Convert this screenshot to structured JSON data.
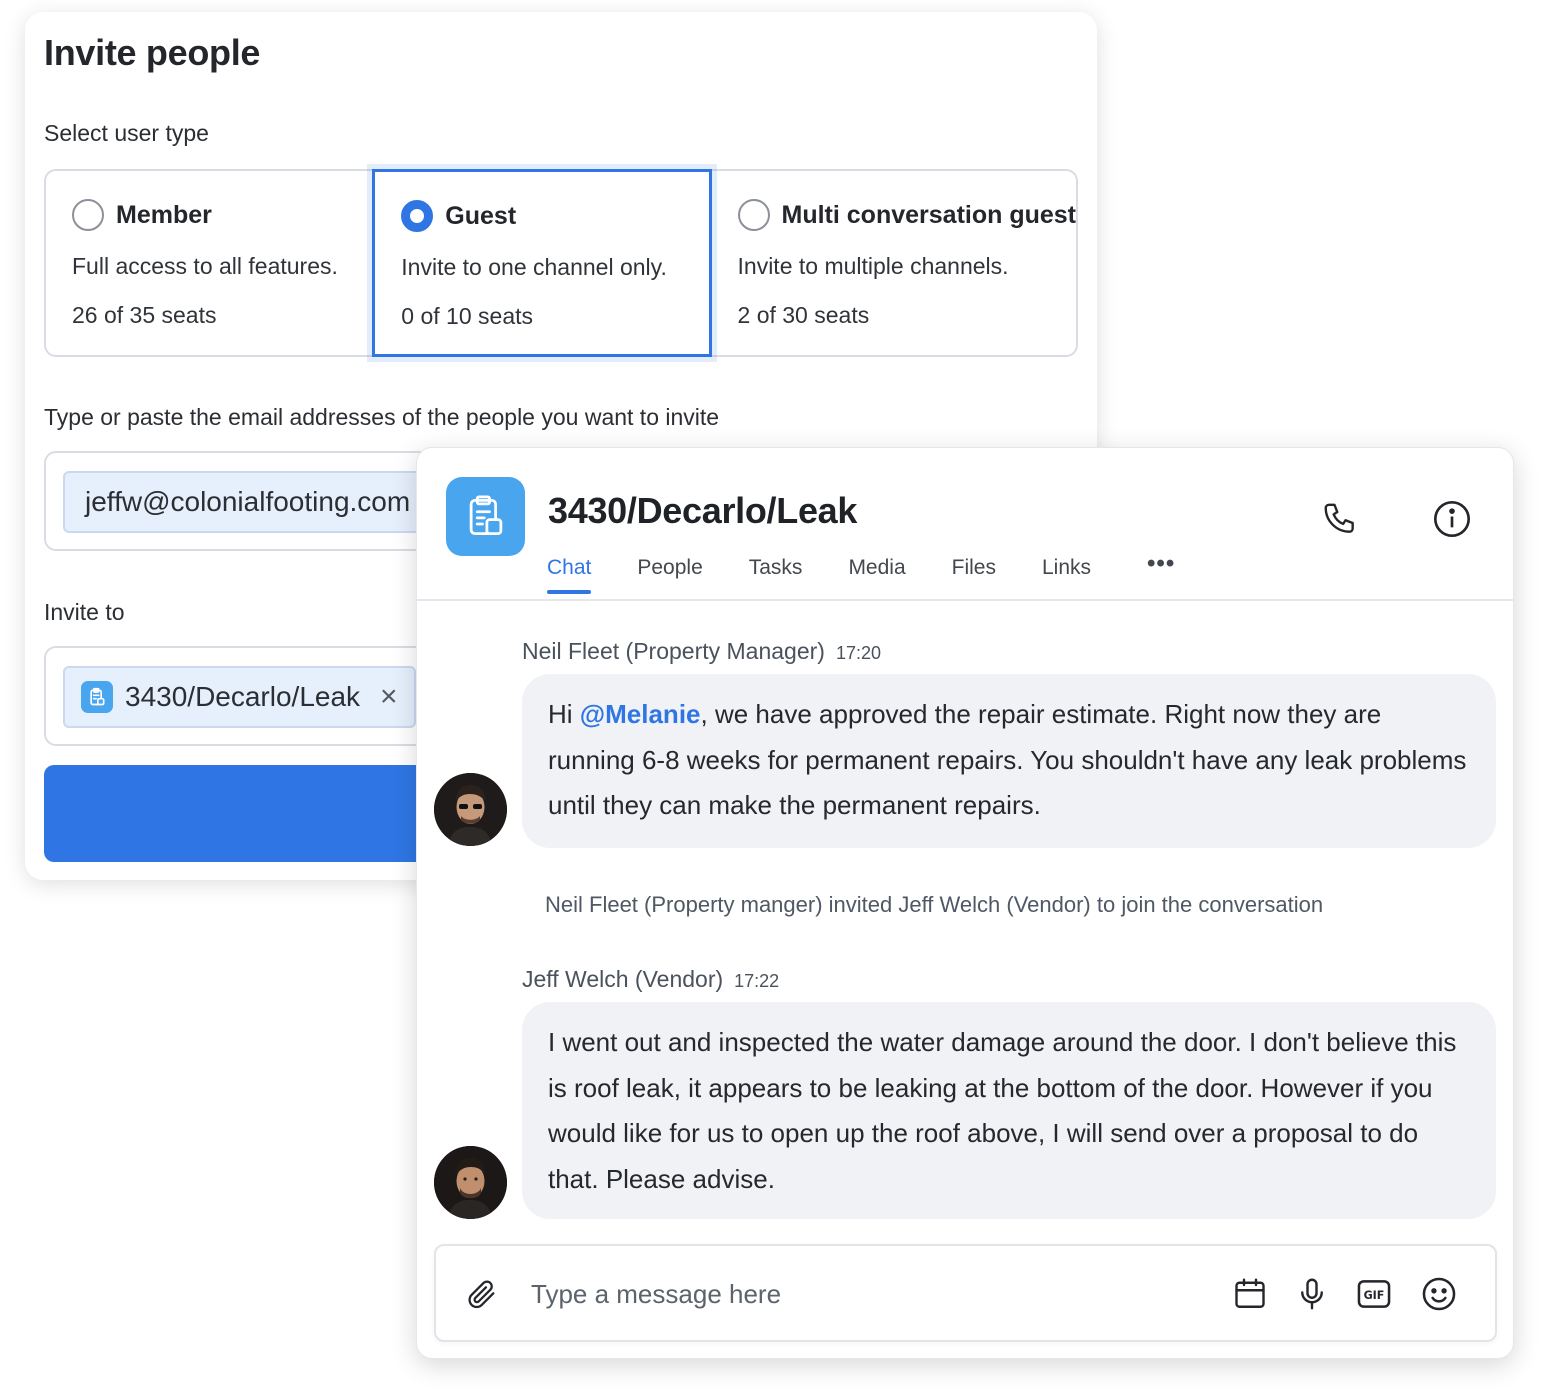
{
  "invite": {
    "title": "Invite people",
    "user_type_label": "Select user type",
    "user_types": [
      {
        "name": "Member",
        "description": "Full access to all features.",
        "seats": "26 of 35 seats",
        "selected": false
      },
      {
        "name": "Guest",
        "description": "Invite to one channel only.",
        "seats": "0 of 10 seats",
        "selected": true
      },
      {
        "name": "Multi conversation guest",
        "description": "Invite to multiple channels.",
        "seats": "2 of 30 seats",
        "selected": false
      }
    ],
    "email_label": "Type or paste the email addresses of the people you want to invite",
    "emails": [
      "jeffw@colonialfooting.com"
    ],
    "invite_to_label": "Invite to",
    "invite_to_channel": "3430/Decarlo/Leak",
    "chip_close": "×",
    "accent_color": "#2f76e4"
  },
  "chat": {
    "channel_name": "3430/Decarlo/Leak",
    "tabs": [
      "Chat",
      "People",
      "Tasks",
      "Media",
      "Files",
      "Links"
    ],
    "active_tab": "Chat",
    "more_tabs": "•••",
    "header_icons": [
      "phone-icon",
      "info-icon"
    ],
    "messages": [
      {
        "author": "Neil Fleet (Property Manager)",
        "time": "17:20",
        "text_before": "Hi ",
        "mention": "@Melanie",
        "text_after": ", we have approved the repair estimate. Right now they are running 6-8 weeks for permanent repairs. You shouldn't have any leak problems until they can make the permanent repairs."
      },
      {
        "author": "Jeff Welch (Vendor)",
        "time": "17:22",
        "text": "I went out and inspected the water damage around the door. I don't believe this is roof leak, it appears to be leaking at the bottom of the door. However if you would like for us to open up the roof above, I will send over a proposal to do that. Please advise."
      }
    ],
    "system_note": "Neil Fleet (Property manger) invited Jeff Welch (Vendor) to join the conversation",
    "composer": {
      "placeholder": "Type a message here",
      "icons": [
        "attachment-icon",
        "calendar-icon",
        "microphone-icon",
        "gif-icon",
        "emoji-icon"
      ]
    },
    "channel_icon_color": "#4aa5ef"
  }
}
